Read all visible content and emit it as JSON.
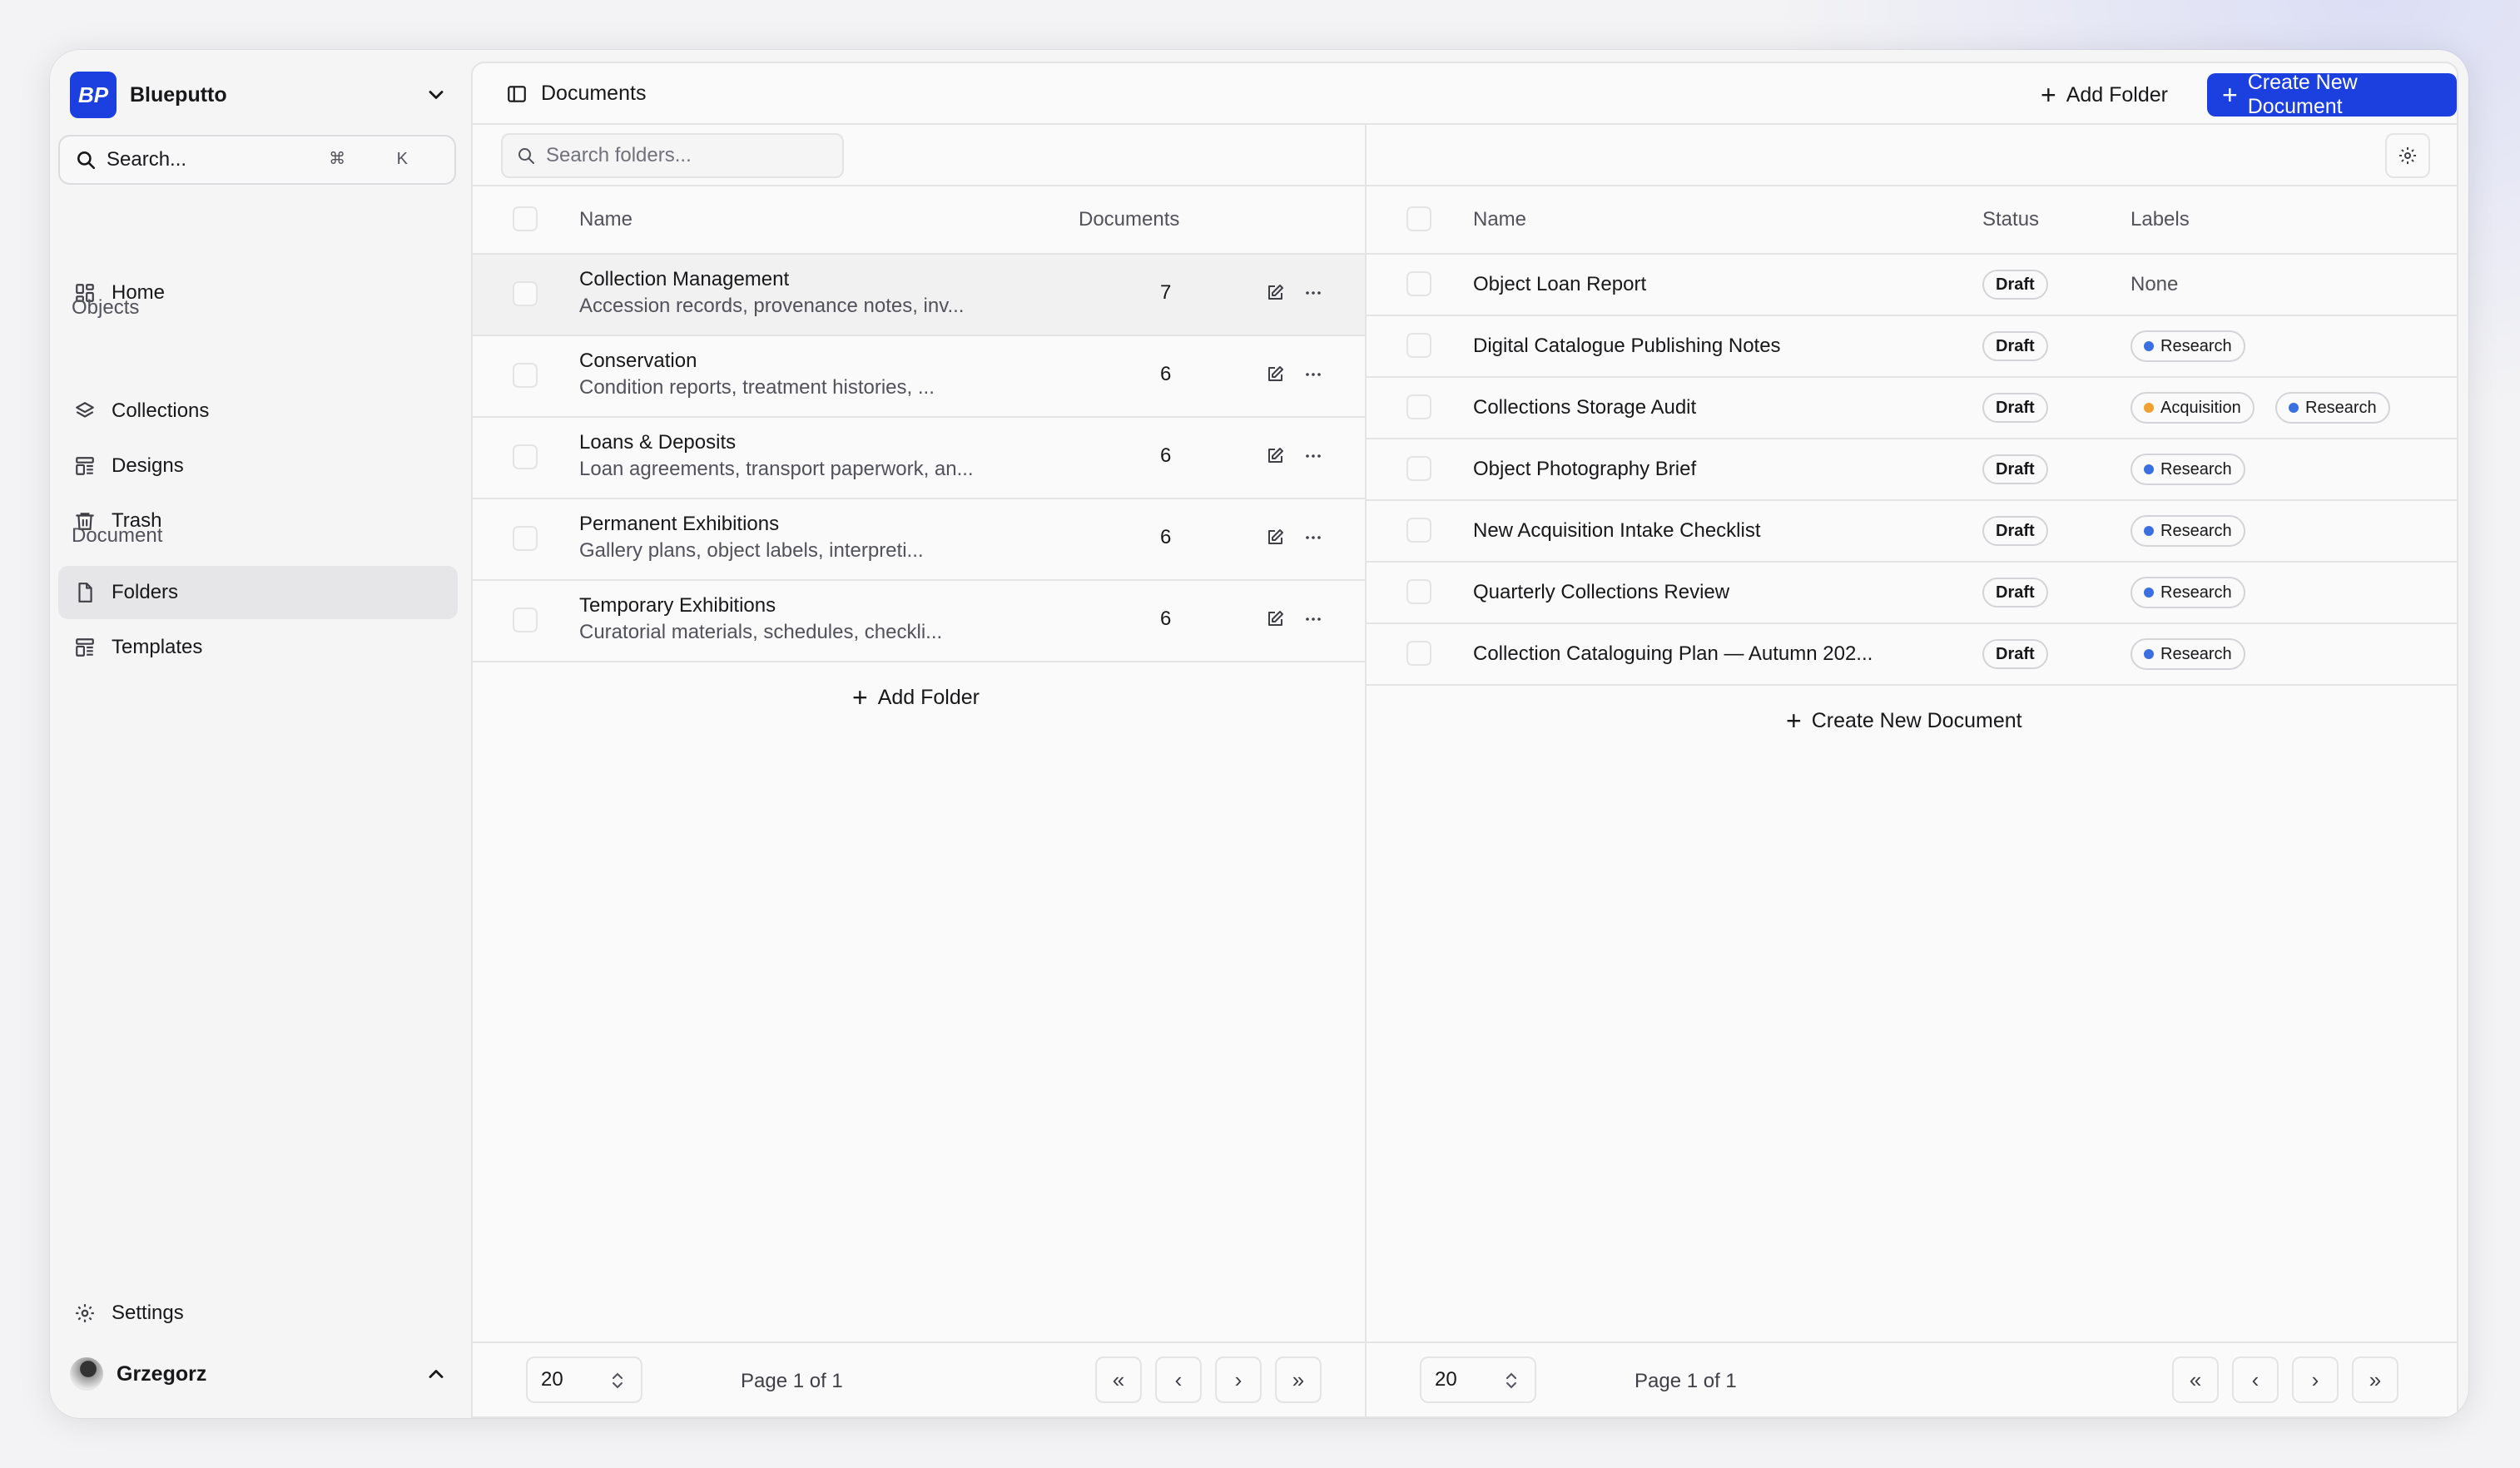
{
  "app": {
    "name": "Blueputto",
    "logo_text": "BP"
  },
  "search": {
    "label": "Search...",
    "shortcut": "⌘ K"
  },
  "sidebar": {
    "home": "Home",
    "objects_section": "Objects",
    "collections": "Collections",
    "designs": "Designs",
    "trash": "Trash",
    "document_section": "Document",
    "folders": "Folders",
    "templates": "Templates",
    "settings": "Settings",
    "user_name": "Grzegorz"
  },
  "header": {
    "title": "Documents",
    "add_folder": "Add Folder",
    "create_document": "Create New Document"
  },
  "folders_pane": {
    "search_placeholder": "Search folders...",
    "columns": {
      "name": "Name",
      "documents": "Documents"
    },
    "rows": [
      {
        "name": "Collection Management",
        "desc": "Accession records, provenance notes, inv...",
        "count": "7"
      },
      {
        "name": "Conservation",
        "desc": "Condition reports, treatment histories, ...",
        "count": "6"
      },
      {
        "name": "Loans & Deposits",
        "desc": "Loan agreements, transport paperwork, an...",
        "count": "6"
      },
      {
        "name": "Permanent Exhibitions",
        "desc": "Gallery plans, object labels, interpreti...",
        "count": "6"
      },
      {
        "name": "Temporary Exhibitions",
        "desc": "Curatorial materials, schedules, checkli...",
        "count": "6"
      }
    ],
    "add_folder": "Add Folder",
    "page_size": "20",
    "page_info": "Page 1 of 1"
  },
  "documents_pane": {
    "columns": {
      "name": "Name",
      "status": "Status",
      "labels": "Labels"
    },
    "rows": [
      {
        "name": "Object Loan Report",
        "status": "Draft",
        "labels": [],
        "none": "None"
      },
      {
        "name": "Digital Catalogue Publishing Notes",
        "status": "Draft",
        "labels": [
          "Research"
        ]
      },
      {
        "name": "Collections Storage Audit",
        "status": "Draft",
        "labels": [
          "Acquisition",
          "Research"
        ]
      },
      {
        "name": "Object Photography Brief",
        "status": "Draft",
        "labels": [
          "Research"
        ]
      },
      {
        "name": "New Acquisition Intake Checklist",
        "status": "Draft",
        "labels": [
          "Research"
        ]
      },
      {
        "name": "Quarterly Collections Review",
        "status": "Draft",
        "labels": [
          "Research"
        ]
      },
      {
        "name": "Collection Cataloguing Plan — Autumn 202...",
        "status": "Draft",
        "labels": [
          "Research"
        ]
      }
    ],
    "create_document": "Create New Document",
    "page_size": "20",
    "page_info": "Page 1 of 1"
  },
  "colors": {
    "primary": "#1c3fe0",
    "research_dot": "#3b6fe0",
    "acquisition_dot": "#f0a030"
  }
}
